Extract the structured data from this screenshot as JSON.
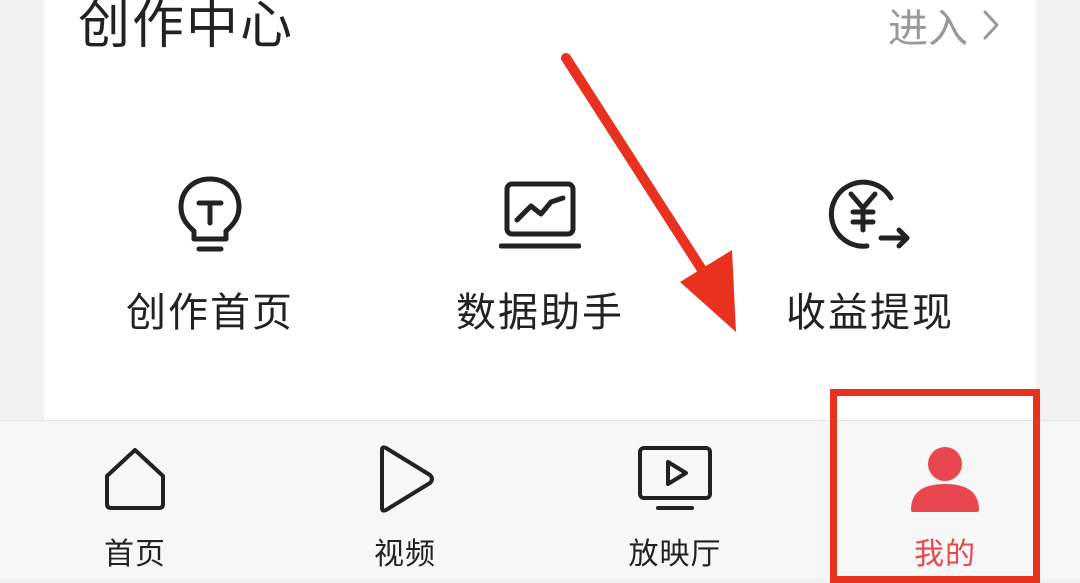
{
  "creator_center": {
    "title": "创作中心",
    "enter_label": "进入",
    "tools": [
      {
        "label": "创作首页",
        "icon": "lightbulb-icon"
      },
      {
        "label": "数据助手",
        "icon": "chart-monitor-icon"
      },
      {
        "label": "收益提现",
        "icon": "yuan-withdraw-icon"
      }
    ]
  },
  "tabbar": {
    "tabs": [
      {
        "label": "首页",
        "icon": "home-icon",
        "active": false
      },
      {
        "label": "视频",
        "icon": "play-icon",
        "active": false
      },
      {
        "label": "放映厅",
        "icon": "tv-play-icon",
        "active": false
      },
      {
        "label": "我的",
        "icon": "user-icon",
        "active": true
      }
    ]
  },
  "colors": {
    "accent": "#e8474f",
    "annotation": "#e8321f",
    "muted": "#999999",
    "text": "#222222"
  }
}
